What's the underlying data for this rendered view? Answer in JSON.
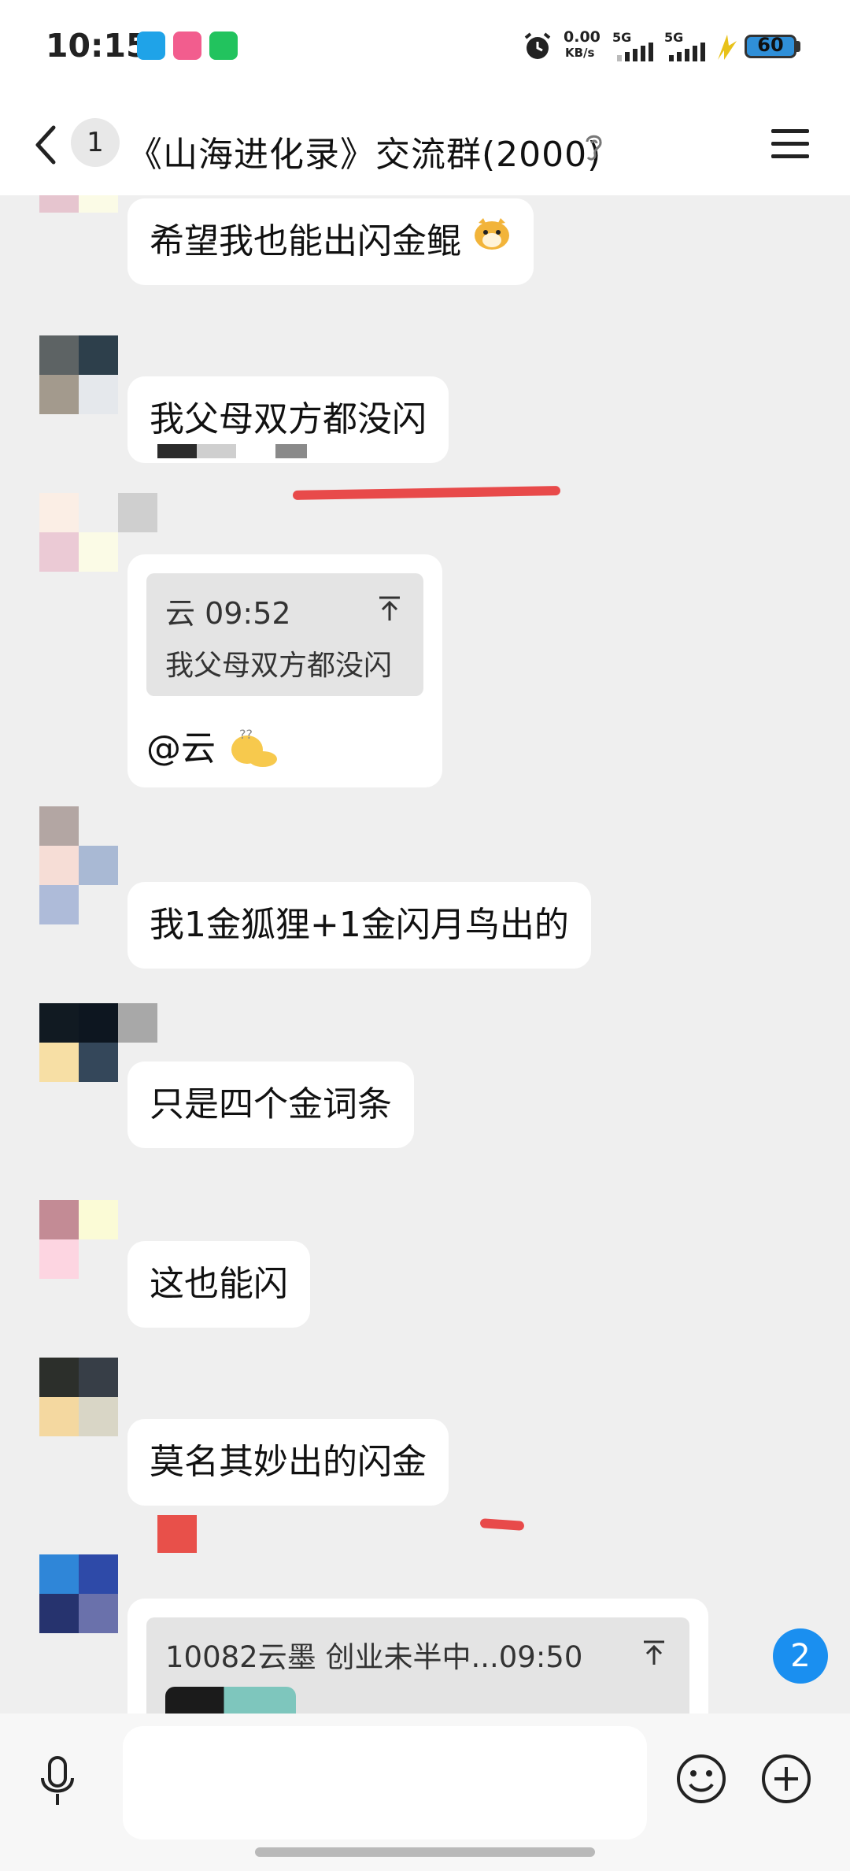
{
  "status_bar": {
    "time": "10:15",
    "net_speed": "0.00",
    "net_unit": "KB/s",
    "sim1": "5G",
    "sim2": "5G",
    "battery": "60",
    "battery_color": "#2f8fd8"
  },
  "header": {
    "unread_count": "1",
    "title": "《山海进化录》交流群(2000)"
  },
  "messages": [
    {
      "text": "希望我也能出闪金鲲"
    },
    {
      "text": "我父母双方都没闪"
    },
    {
      "quote_meta": "云 09:52",
      "quote_text": "我父母双方都没闪",
      "text": "@云"
    },
    {
      "text": "我1金狐狸+1金闪月鸟出的"
    },
    {
      "text": "只是四个金词条"
    },
    {
      "text": "这也能闪"
    },
    {
      "text": "莫名其妙出的闪金"
    },
    {
      "quote_meta": "10082云墨 创业未半中...09:50"
    }
  ],
  "unread_badge": "2",
  "colors": {
    "background": "#efefef",
    "bubble": "#ffffff",
    "quote": "#e4e4e4",
    "annotation_red": "#e84a4a",
    "badge_blue": "#1a8ff0"
  },
  "icons": {
    "back": "back-icon",
    "menu": "menu-icon",
    "ear": "ear-icon",
    "mic": "mic-icon",
    "emoji": "smile-icon",
    "plus": "plus-icon",
    "pin": "pin-icon"
  }
}
